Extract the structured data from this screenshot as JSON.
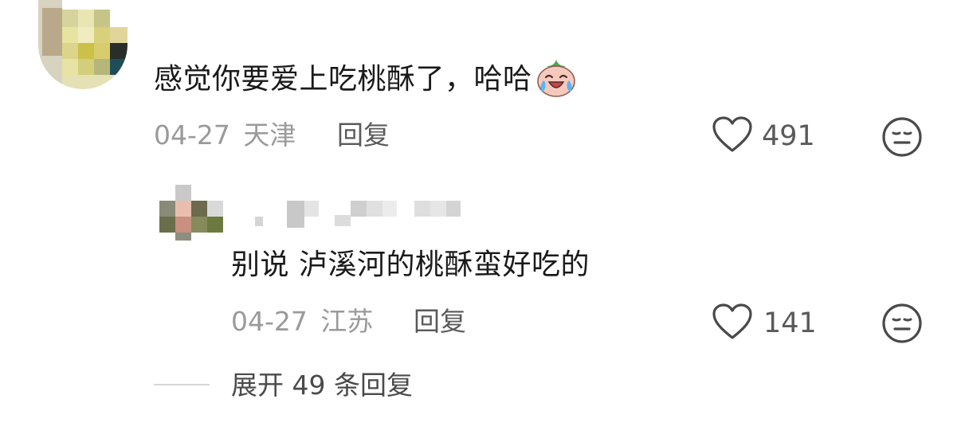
{
  "comment": {
    "text": "感觉你要爱上吃桃酥了，哈哈",
    "emoji_icon": "crying-laughing-peach-emoji",
    "date": "04-27",
    "location": "天津",
    "reply_label": "回复",
    "likes": "491",
    "like_icon": "heart-outline-icon",
    "dislike_icon": "meh-face-icon"
  },
  "reply": {
    "text": "别说 泸溪河的桃酥蛮好吃的",
    "date": "04-27",
    "location": "江苏",
    "reply_label": "回复",
    "likes": "141",
    "like_icon": "heart-outline-icon",
    "dislike_icon": "meh-face-icon"
  },
  "expand": {
    "label": "展开 49 条回复"
  },
  "colors": {
    "text_primary": "#1a1a1a",
    "text_meta": "#9a9a9a",
    "text_action": "#5a5a5a",
    "icon": "#4a4a4a"
  }
}
